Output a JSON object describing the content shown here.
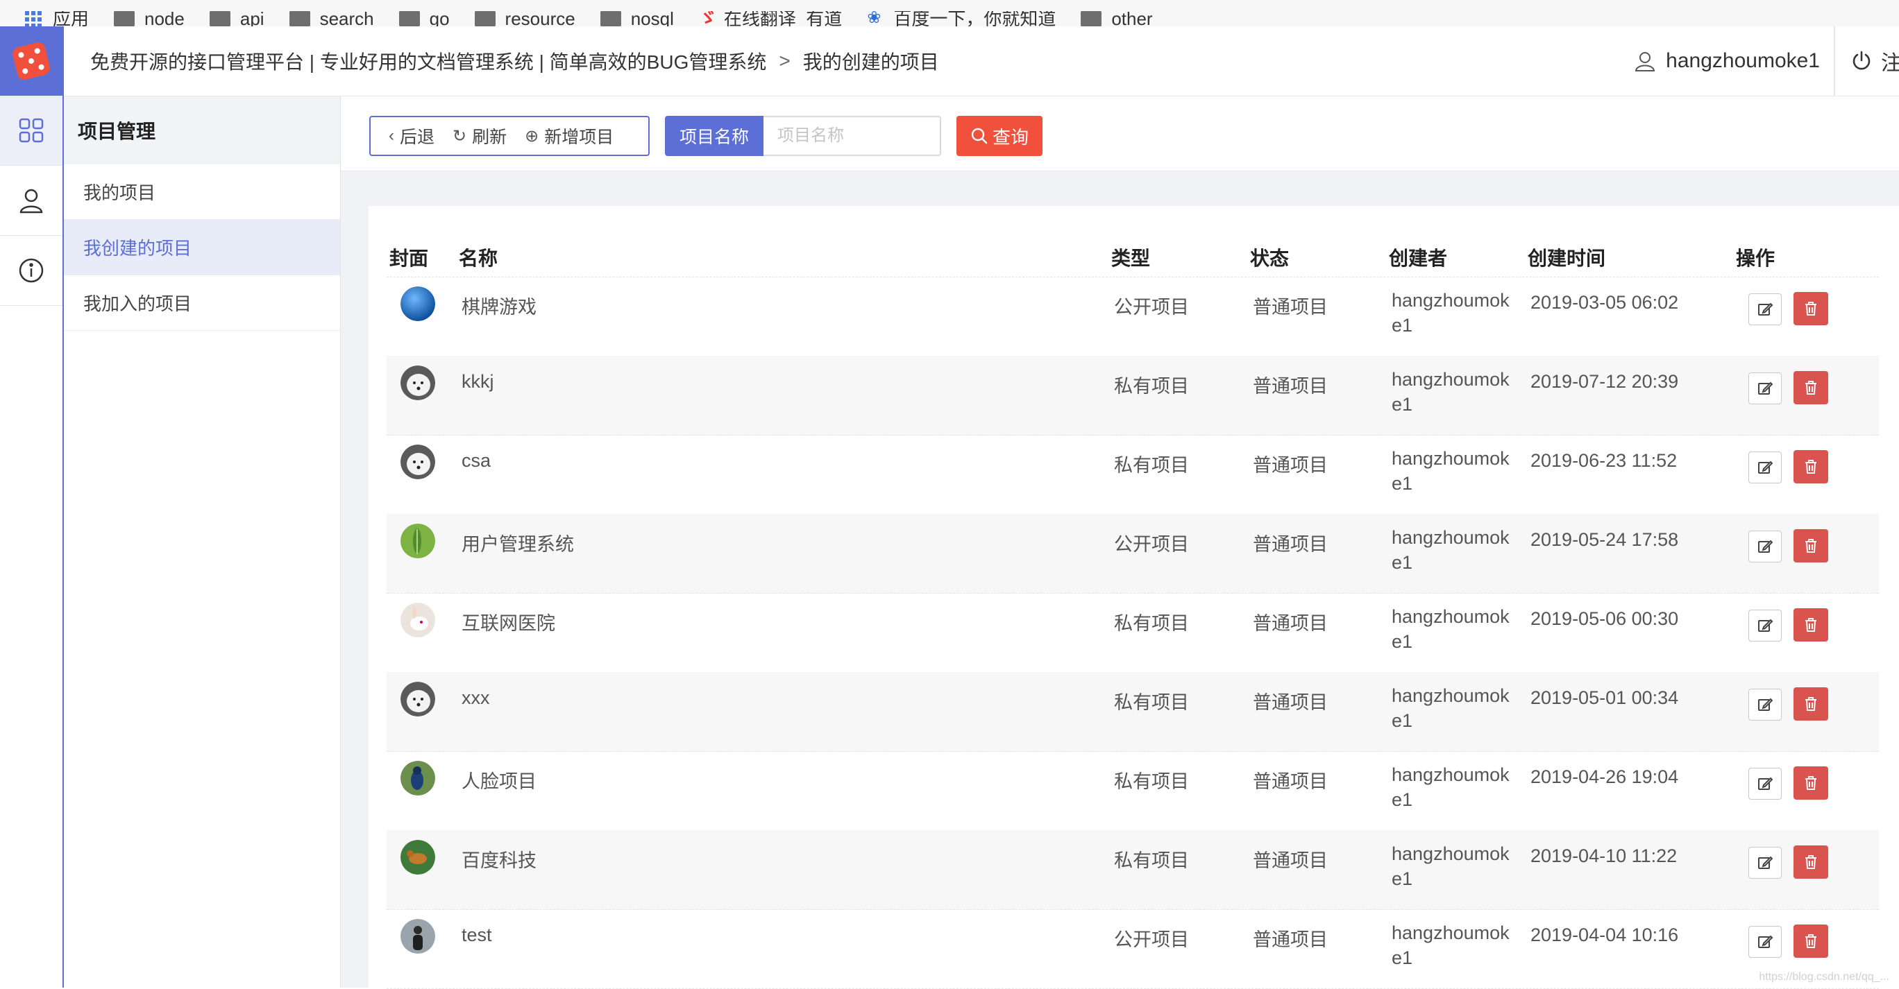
{
  "bookmarks": [
    {
      "label": "应用",
      "icon": "apps-grid-icon"
    },
    {
      "label": "node",
      "icon": "folder-icon"
    },
    {
      "label": "api",
      "icon": "folder-icon"
    },
    {
      "label": "search",
      "icon": "folder-icon"
    },
    {
      "label": "go",
      "icon": "folder-icon"
    },
    {
      "label": "resource",
      "icon": "folder-icon"
    },
    {
      "label": "nosql",
      "icon": "folder-icon"
    },
    {
      "label": "在线翻译_有道",
      "icon": "youdao-icon"
    },
    {
      "label": "百度一下，你就知道",
      "icon": "baidu-icon"
    },
    {
      "label": "other",
      "icon": "folder-icon"
    }
  ],
  "header": {
    "breadcrumb_main": "免费开源的接口管理平台 | 专业好用的文档管理系统 | 简单高效的BUG管理系统",
    "breadcrumb_sep": ">",
    "breadcrumb_current": "我的创建的项目",
    "username": "hangzhoumoke1",
    "logout_label": "注销"
  },
  "sidebar": {
    "title": "项目管理",
    "items": [
      {
        "label": "我的项目"
      },
      {
        "label": "我创建的项目",
        "active": true
      },
      {
        "label": "我加入的项目"
      }
    ]
  },
  "toolbar": {
    "back_label": "后退",
    "refresh_label": "刷新",
    "add_label": "新增项目",
    "search_field_label": "项目名称",
    "search_placeholder": "项目名称",
    "query_label": "查询"
  },
  "table": {
    "columns": [
      "封面",
      "名称",
      "类型",
      "状态",
      "创建者",
      "创建时间",
      "操作"
    ],
    "rows": [
      {
        "name": "棋牌游戏",
        "type": "公开项目",
        "status": "普通项目",
        "creator": "hangzhoumoke1",
        "created": "2019-03-05 06:02",
        "cover": "blue-globe"
      },
      {
        "name": "kkkj",
        "type": "私有项目",
        "status": "普通项目",
        "creator": "hangzhoumoke1",
        "created": "2019-07-12 20:39",
        "cover": "white-dog"
      },
      {
        "name": "csa",
        "type": "私有项目",
        "status": "普通项目",
        "creator": "hangzhoumoke1",
        "created": "2019-06-23 11:52",
        "cover": "white-dog"
      },
      {
        "name": "用户管理系统",
        "type": "公开项目",
        "status": "普通项目",
        "creator": "hangzhoumoke1",
        "created": "2019-05-24 17:58",
        "cover": "green-leaf"
      },
      {
        "name": "互联网医院",
        "type": "私有项目",
        "status": "普通项目",
        "creator": "hangzhoumoke1",
        "created": "2019-05-06 00:30",
        "cover": "rabbit"
      },
      {
        "name": "xxx",
        "type": "私有项目",
        "status": "普通项目",
        "creator": "hangzhoumoke1",
        "created": "2019-05-01 00:34",
        "cover": "white-dog"
      },
      {
        "name": "人脸项目",
        "type": "私有项目",
        "status": "普通项目",
        "creator": "hangzhoumoke1",
        "created": "2019-04-26 19:04",
        "cover": "bird"
      },
      {
        "name": "百度科技",
        "type": "私有项目",
        "status": "普通项目",
        "creator": "hangzhoumoke1",
        "created": "2019-04-10 11:22",
        "cover": "deer"
      },
      {
        "name": "test",
        "type": "公开项目",
        "status": "普通项目",
        "creator": "hangzhoumoke1",
        "created": "2019-04-04 10:16",
        "cover": "person"
      }
    ]
  },
  "watermark": "https://blog.csdn.net/qq_..."
}
